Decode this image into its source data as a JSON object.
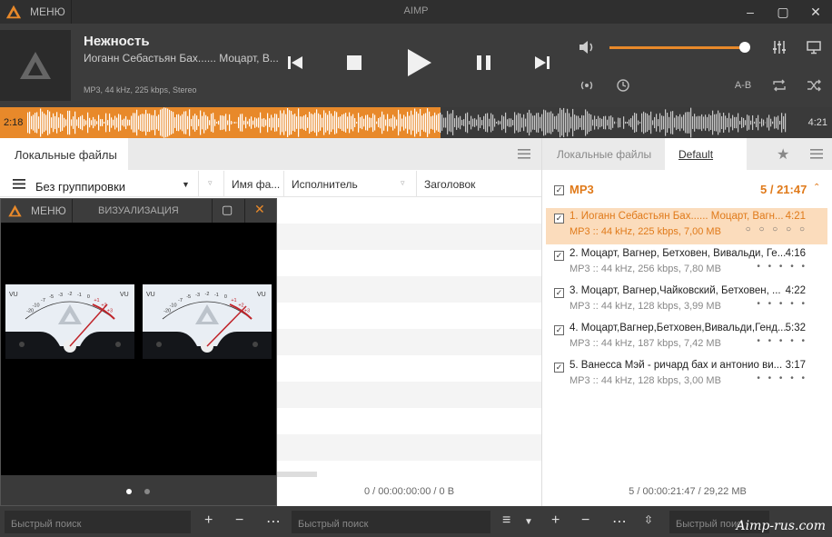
{
  "titlebar": {
    "menu_label": "МЕНЮ",
    "app_title": "AIMP"
  },
  "now_playing": {
    "title": "Нежность",
    "artist": "Иоганн Себастьян Бах...... Моцарт, В...",
    "info": "MP3, 44 kHz, 225 kbps, Stereo",
    "ab_label": "A-B",
    "volume_fraction": 0.98
  },
  "waveform": {
    "elapsed": "2:18",
    "total": "4:21",
    "progress_fraction": 0.53
  },
  "left_panel": {
    "tab_label": "Локальные файлы",
    "grouping_label": "Без группировки",
    "columns": [
      "Имя фа...",
      "Исполнитель",
      "Заголовок"
    ],
    "status": "0 / 00:00:00:00 / 0 B"
  },
  "right_panel": {
    "tabs": [
      "Локальные файлы",
      "Default"
    ],
    "group": {
      "name": "MP3",
      "summary": "5 / 21:47"
    },
    "items": [
      {
        "title": "1. Иоганн Себастьян Бах...... Моцарт, Вагн...",
        "info": "MP3 :: 44 kHz, 225 kbps, 7,00 MB",
        "duration": "4:21",
        "rating": "○ ○ ○ ○ ○"
      },
      {
        "title": "2. Моцарт, Вагнер, Бетховен, Вивальди, Ге...",
        "info": "MP3 :: 44 kHz, 256 kbps, 7,80 MB",
        "duration": "4:16",
        "rating": "• • • • •"
      },
      {
        "title": "3. Моцарт, Вагнер,Чайковский, Бетховен, ...",
        "info": "MP3 :: 44 kHz, 128 kbps, 3,99 MB",
        "duration": "4:22",
        "rating": "• • • • •"
      },
      {
        "title": "4. Моцарт,Вагнер,Бетховен,Вивальди,Генд...",
        "info": "MP3 :: 44 kHz, 187 kbps, 7,42 MB",
        "duration": "5:32",
        "rating": "• • • • •"
      },
      {
        "title": "5. Ванесса Мэй - ричард бах и антонио ви...",
        "info": "MP3 :: 44 kHz, 128 kbps, 3,00 MB",
        "duration": "3:17",
        "rating": "• • • • •"
      }
    ],
    "status": "5 / 00:00:21:47 / 29,22 MB"
  },
  "bottombar": {
    "left_search_placeholder": "Быстрый поиск",
    "mid_search_placeholder": "Быстрый поиск",
    "right_search_placeholder": "Быстрый поис",
    "watermark": "Aimp-rus.com"
  },
  "visualization": {
    "menu_label": "МЕНЮ",
    "title": "ВИЗУАЛИЗАЦИЯ",
    "meter_label": "VU",
    "scale": [
      "-20",
      "-10",
      "-7",
      "-5",
      "-3",
      "-2",
      "-1",
      "0",
      "+1",
      "+2",
      "+3"
    ]
  },
  "colors": {
    "accent": "#e8892a",
    "dark": "#3a3a3a"
  }
}
